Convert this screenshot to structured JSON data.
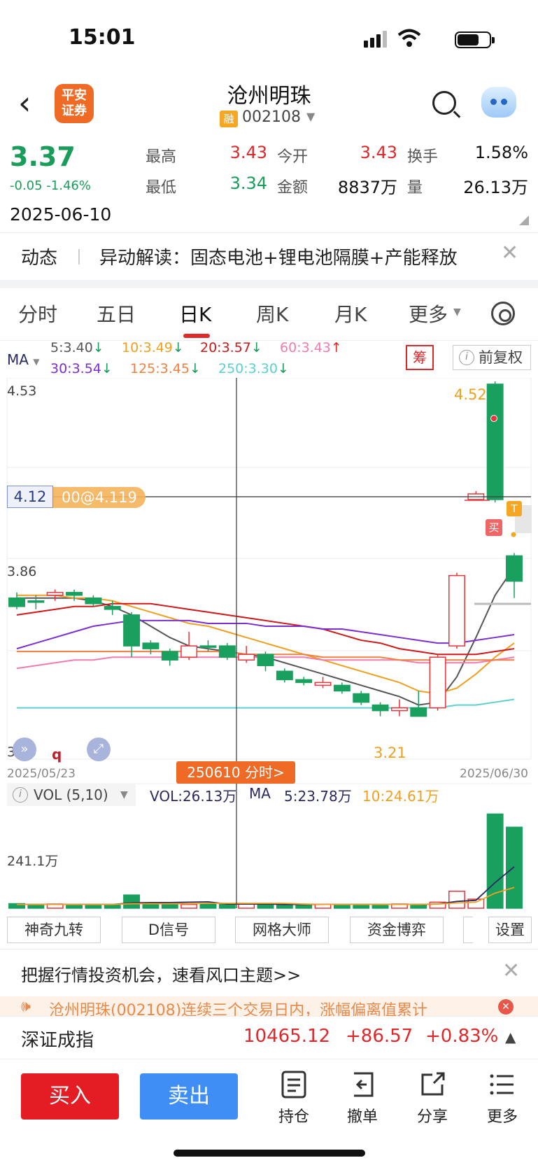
{
  "status_bar": {
    "time": "15:01"
  },
  "header": {
    "broker_logo_line1": "平安",
    "broker_logo_line2": "证券",
    "stock_name": "沧州明珠",
    "rong_badge": "融",
    "stock_code": "002108"
  },
  "quote": {
    "last_price": "3.37",
    "change": "-0.05 -1.46%",
    "date": "2025-06-10",
    "high_label": "最高",
    "high": "3.43",
    "open_label": "今开",
    "open": "3.43",
    "turnover_label": "换手",
    "turnover": "1.58%",
    "low_label": "最低",
    "low": "3.34",
    "amount_label": "金额",
    "amount": "8837万",
    "volume_label": "量",
    "volume": "26.13万"
  },
  "news": {
    "tag": "动态",
    "text": "异动解读：固态电池+锂电池隔膜+产能释放"
  },
  "period_tabs": [
    "分时",
    "五日",
    "日K",
    "周K",
    "月K",
    "更多"
  ],
  "active_tab": "日K",
  "ma_legend": {
    "label": "MA",
    "row1": [
      {
        "text": "5:3.40",
        "arrow": "↓",
        "color": "#555555"
      },
      {
        "text": "10:3.49",
        "arrow": "↓",
        "color": "#f0a020"
      },
      {
        "text": "20:3.57",
        "arrow": "↓",
        "color": "#d01818"
      },
      {
        "text": "60:3.43",
        "arrow": "↑",
        "color": "#f07cb0"
      }
    ],
    "row2": [
      {
        "text": "30:3.54",
        "arrow": "↓",
        "color": "#7b2fd0"
      },
      {
        "text": "125:3.45",
        "arrow": "↓",
        "color": "#f08040"
      },
      {
        "text": "250:3.30",
        "arrow": "↓",
        "color": "#5ccfd0"
      }
    ],
    "chou_button": "筹",
    "fuquan_button": "前复权"
  },
  "chart_labels": {
    "y_top": "4.53",
    "y_mid": "3.86",
    "y_bottom": "3.20",
    "crosshair_price": "4.12",
    "order_pill": "00@4.119",
    "high_marker": "4.52",
    "low_marker": "3.21",
    "t_badge": "T",
    "buy_badge": "买",
    "q_mark": "q",
    "date_start": "2025/05/23",
    "date_end": "2025/06/30",
    "fenshi_button": "250610 分时>"
  },
  "chart_data": {
    "type": "candlestick",
    "x_range": [
      "2025/05/23",
      "2025/06/30"
    ],
    "ylim": [
      3.2,
      4.53
    ],
    "y_ticks": [
      4.53,
      3.86,
      3.2
    ],
    "crosshair": {
      "date": "250610",
      "price": 4.12
    },
    "high_marker": 4.52,
    "low_marker": 3.21,
    "candles": [
      {
        "o": 3.76,
        "c": 3.73,
        "h": 3.78,
        "l": 3.72
      },
      {
        "o": 3.75,
        "c": 3.75,
        "h": 3.77,
        "l": 3.72
      },
      {
        "o": 3.77,
        "c": 3.78,
        "h": 3.79,
        "l": 3.75
      },
      {
        "o": 3.78,
        "c": 3.77,
        "h": 3.79,
        "l": 3.75
      },
      {
        "o": 3.76,
        "c": 3.74,
        "h": 3.77,
        "l": 3.73
      },
      {
        "o": 3.73,
        "c": 3.72,
        "h": 3.75,
        "l": 3.7
      },
      {
        "o": 3.7,
        "c": 3.59,
        "h": 3.71,
        "l": 3.55
      },
      {
        "o": 3.6,
        "c": 3.58,
        "h": 3.61,
        "l": 3.56
      },
      {
        "o": 3.57,
        "c": 3.54,
        "h": 3.58,
        "l": 3.52
      },
      {
        "o": 3.55,
        "c": 3.59,
        "h": 3.64,
        "l": 3.54
      },
      {
        "o": 3.59,
        "c": 3.59,
        "h": 3.61,
        "l": 3.57
      },
      {
        "o": 3.59,
        "c": 3.55,
        "h": 3.6,
        "l": 3.54
      },
      {
        "o": 3.54,
        "c": 3.56,
        "h": 3.59,
        "l": 3.53
      },
      {
        "o": 3.56,
        "c": 3.52,
        "h": 3.57,
        "l": 3.5
      },
      {
        "o": 3.5,
        "c": 3.47,
        "h": 3.51,
        "l": 3.46
      },
      {
        "o": 3.47,
        "c": 3.46,
        "h": 3.48,
        "l": 3.45
      },
      {
        "o": 3.45,
        "c": 3.46,
        "h": 3.48,
        "l": 3.44
      },
      {
        "o": 3.45,
        "c": 3.43,
        "h": 3.46,
        "l": 3.42
      },
      {
        "o": 3.42,
        "c": 3.39,
        "h": 3.43,
        "l": 3.38
      },
      {
        "o": 3.38,
        "c": 3.36,
        "h": 3.39,
        "l": 3.34
      },
      {
        "o": 3.36,
        "c": 3.37,
        "h": 3.4,
        "l": 3.34
      },
      {
        "o": 3.37,
        "c": 3.34,
        "h": 3.43,
        "l": 3.34
      },
      {
        "o": 3.37,
        "c": 3.55,
        "h": 3.56,
        "l": 3.36
      },
      {
        "o": 3.59,
        "c": 3.84,
        "h": 3.85,
        "l": 3.58
      },
      {
        "o": 4.11,
        "c": 4.13,
        "h": 4.14,
        "l": 4.11
      },
      {
        "o": 4.52,
        "c": 4.11,
        "h": 4.53,
        "l": 4.1
      },
      {
        "o": 3.91,
        "c": 3.82,
        "h": 3.92,
        "l": 3.76
      }
    ],
    "ma_lines": [
      {
        "name": "5",
        "color": "#555555",
        "values": [
          3.76,
          3.76,
          3.76,
          3.76,
          3.75,
          3.73,
          3.7,
          3.66,
          3.62,
          3.59,
          3.58,
          3.57,
          3.56,
          3.55,
          3.53,
          3.51,
          3.49,
          3.47,
          3.45,
          3.43,
          3.41,
          3.38,
          3.39,
          3.48,
          3.62,
          3.77,
          3.87
        ]
      },
      {
        "name": "10",
        "color": "#f0a020",
        "values": [
          3.77,
          3.77,
          3.77,
          3.76,
          3.76,
          3.75,
          3.73,
          3.71,
          3.69,
          3.67,
          3.66,
          3.64,
          3.62,
          3.6,
          3.58,
          3.56,
          3.54,
          3.52,
          3.5,
          3.48,
          3.46,
          3.43,
          3.42,
          3.44,
          3.49,
          3.55,
          3.6
        ]
      },
      {
        "name": "20",
        "color": "#d01818",
        "values": [
          3.7,
          3.71,
          3.72,
          3.73,
          3.73,
          3.74,
          3.74,
          3.74,
          3.73,
          3.72,
          3.71,
          3.7,
          3.69,
          3.68,
          3.67,
          3.66,
          3.65,
          3.63,
          3.61,
          3.6,
          3.58,
          3.57,
          3.56,
          3.56,
          3.56,
          3.57,
          3.58
        ]
      },
      {
        "name": "30",
        "color": "#7b2fd0",
        "values": [
          3.58,
          3.6,
          3.62,
          3.64,
          3.66,
          3.67,
          3.68,
          3.68,
          3.68,
          3.68,
          3.67,
          3.67,
          3.67,
          3.66,
          3.66,
          3.66,
          3.65,
          3.65,
          3.64,
          3.63,
          3.62,
          3.61,
          3.6,
          3.6,
          3.61,
          3.62,
          3.63
        ]
      },
      {
        "name": "60",
        "color": "#f07cb0",
        "values": [
          3.51,
          3.52,
          3.53,
          3.54,
          3.54,
          3.55,
          3.55,
          3.55,
          3.55,
          3.55,
          3.55,
          3.55,
          3.55,
          3.55,
          3.55,
          3.55,
          3.54,
          3.54,
          3.54,
          3.54,
          3.54,
          3.53,
          3.53,
          3.53,
          3.53,
          3.54,
          3.55
        ]
      },
      {
        "name": "125",
        "color": "#f08040",
        "values": [
          3.57,
          3.57,
          3.57,
          3.57,
          3.57,
          3.57,
          3.57,
          3.57,
          3.57,
          3.57,
          3.57,
          3.57,
          3.56,
          3.56,
          3.56,
          3.56,
          3.55,
          3.55,
          3.55,
          3.55,
          3.54,
          3.54,
          3.54,
          3.54,
          3.54,
          3.54,
          3.54
        ]
      },
      {
        "name": "250",
        "color": "#5ccfd0",
        "values": [
          3.37,
          3.37,
          3.37,
          3.37,
          3.37,
          3.37,
          3.37,
          3.37,
          3.37,
          3.37,
          3.37,
          3.37,
          3.37,
          3.37,
          3.37,
          3.37,
          3.37,
          3.37,
          3.37,
          3.37,
          3.37,
          3.37,
          3.37,
          3.38,
          3.38,
          3.39,
          3.4
        ]
      }
    ],
    "volume": {
      "axis_label_value": 241.1,
      "values": [
        12,
        10,
        11,
        9,
        10,
        9,
        35,
        12,
        11,
        10,
        11,
        10,
        11,
        10,
        10,
        9,
        10,
        9,
        10,
        9,
        11,
        10,
        16,
        45,
        24,
        250,
        215
      ],
      "ma5": [
        10,
        10,
        10,
        10,
        10,
        10,
        14,
        15,
        15,
        16,
        17,
        11,
        11,
        11,
        10,
        10,
        10,
        10,
        10,
        10,
        10,
        10,
        11,
        18,
        21,
        68,
        110
      ],
      "ma10": [
        10,
        10,
        10,
        10,
        10,
        10,
        12,
        12,
        12,
        12,
        13,
        13,
        13,
        13,
        13,
        11,
        10,
        10,
        10,
        10,
        10,
        10,
        11,
        14,
        16,
        40,
        55
      ]
    }
  },
  "vol_legend": {
    "selector": "VOL (5,10)",
    "vol": "VOL:26.13万",
    "ma_label": "MA",
    "ma5": "5:23.78万",
    "ma10": "10:24.61万",
    "axis_label": "241.1万"
  },
  "indicator_tools": [
    "神奇九转",
    "D信号",
    "网格大师",
    "资金博弈",
    "设置"
  ],
  "promo": {
    "text": "把握行情投资机会，速看风口主题>>"
  },
  "notice": {
    "text": "沧州明珠(002108)连续三个交易日内，涨幅偏离值累计"
  },
  "index_bar": {
    "name": "深证成指",
    "value": "10465.12",
    "change": "+86.57",
    "pct": "+0.83%"
  },
  "actions": {
    "buy": "买入",
    "sell": "卖出",
    "positions": "持仓",
    "cancel": "撤单",
    "share": "分享",
    "more": "更多"
  }
}
